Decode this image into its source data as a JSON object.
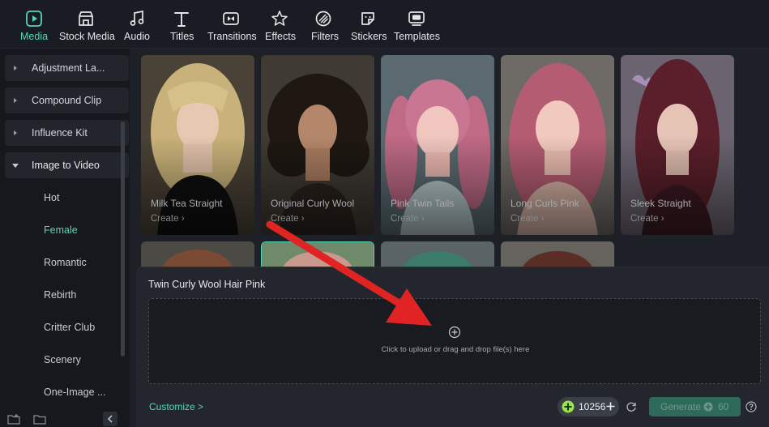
{
  "toolbar": {
    "tabs": [
      {
        "label": "Media",
        "icon": "media-icon",
        "active": true
      },
      {
        "label": "Stock Media",
        "icon": "stock-media-icon"
      },
      {
        "label": "Audio",
        "icon": "music-note-icon"
      },
      {
        "label": "Titles",
        "icon": "text-t-icon"
      },
      {
        "label": "Transitions",
        "icon": "transitions-icon"
      },
      {
        "label": "Effects",
        "icon": "effects-star-icon"
      },
      {
        "label": "Filters",
        "icon": "filters-icon"
      },
      {
        "label": "Stickers",
        "icon": "sticker-icon"
      },
      {
        "label": "Templates",
        "icon": "templates-icon"
      }
    ]
  },
  "sidebar": {
    "categories": [
      {
        "label": "Adjustment La...",
        "expanded": false
      },
      {
        "label": "Compound Clip",
        "expanded": false
      },
      {
        "label": "Influence Kit",
        "expanded": false
      },
      {
        "label": "Image to Video",
        "expanded": true
      }
    ],
    "subitems": [
      {
        "label": "Hot"
      },
      {
        "label": "Female",
        "active": true
      },
      {
        "label": "Romantic"
      },
      {
        "label": "Rebirth"
      },
      {
        "label": "Critter Club"
      },
      {
        "label": "Scenery"
      },
      {
        "label": "One-Image ..."
      }
    ]
  },
  "cards": [
    {
      "title": "Milk Tea Straight",
      "action": "Create ›",
      "hair": "#c9b27a"
    },
    {
      "title": "Original Curly Wool",
      "action": "Create ›",
      "hair": "#1e1712"
    },
    {
      "title": "Pink Twin Tails",
      "action": "Create ›",
      "hair": "#c06a86"
    },
    {
      "title": "Long Curls Pink",
      "action": "Create ›",
      "hair": "#b45c72"
    },
    {
      "title": "Sleek Straight",
      "action": "Create ›",
      "hair": "#5a1f2a"
    }
  ],
  "panel": {
    "title": "Twin Curly Wool Hair Pink",
    "upload_text": "Click to upload or drag and drop file(s) here",
    "customize": "Customize >",
    "credits": "10256",
    "generate_label": "Generate",
    "generate_cost": "60"
  },
  "colors": {
    "accent": "#55d6b8",
    "annotation": "#e02424"
  }
}
